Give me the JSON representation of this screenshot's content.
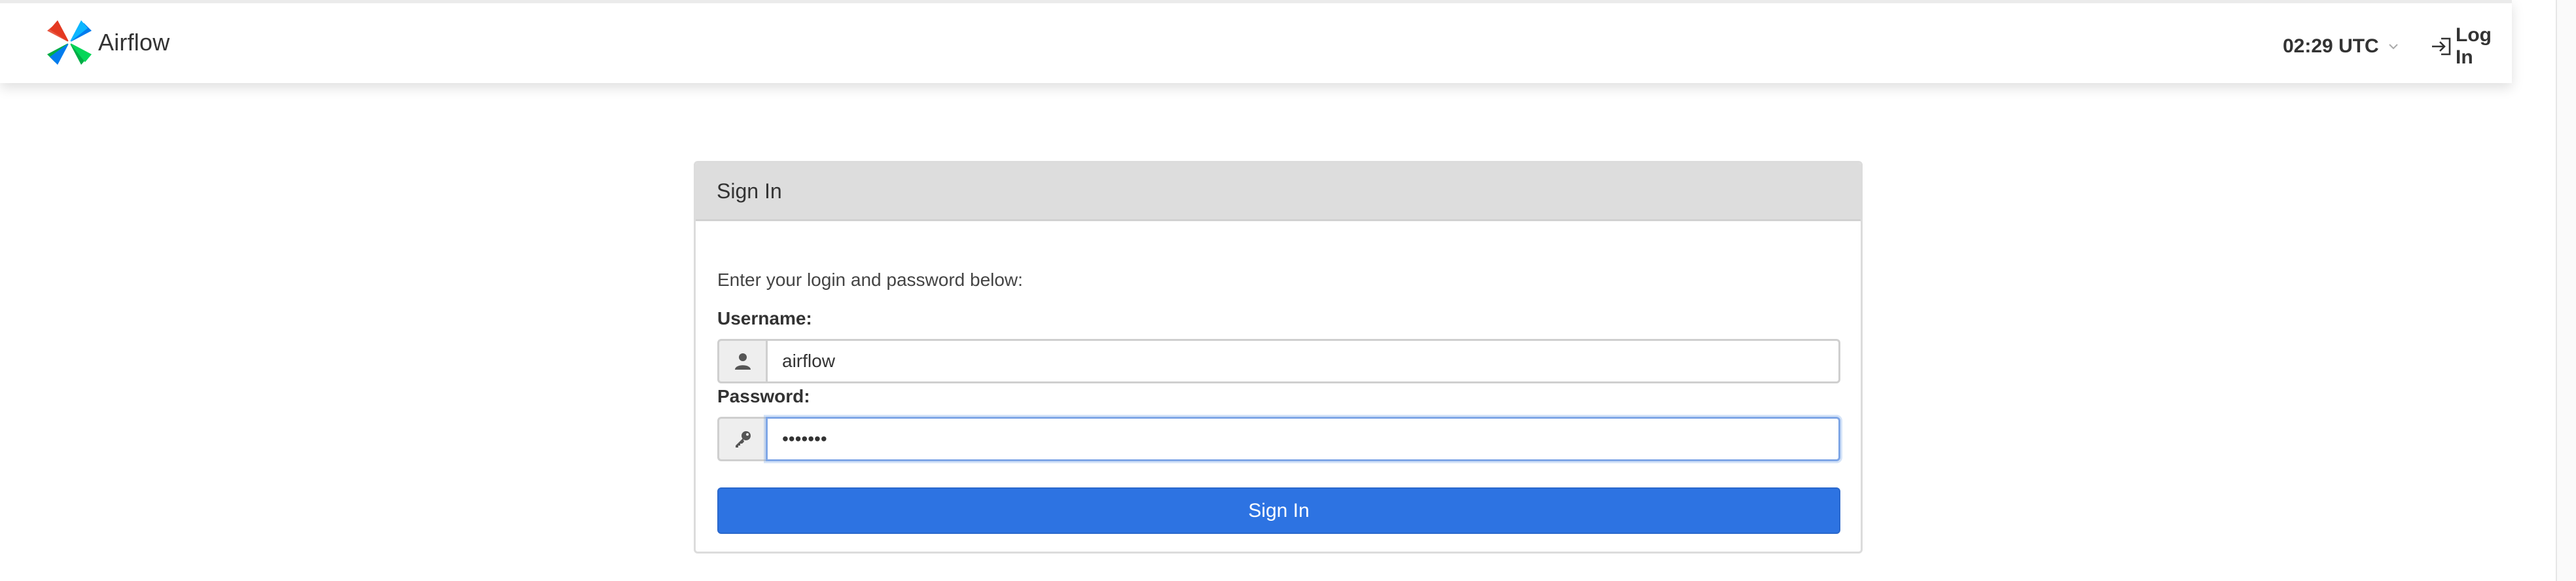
{
  "brand": {
    "name": "Airflow",
    "logo_icon": "airflow-pinwheel-icon"
  },
  "header": {
    "clock_label": "02:29 UTC",
    "clock_icon": "chevron-down-icon",
    "login_label": "Log In",
    "login_icon": "login-icon"
  },
  "signin": {
    "title": "Sign In",
    "intro": "Enter your login and password below:",
    "username_label": "Username:",
    "username_value": "airflow",
    "username_icon": "user-icon",
    "password_label": "Password:",
    "password_value": "airflow",
    "password_icon": "key-icon",
    "button_label": "Sign In"
  },
  "colors": {
    "primary_button": "#2d73e2",
    "panel_header": "#dddddd",
    "input_focus_border": "#7fa6e6",
    "text": "#333333"
  }
}
